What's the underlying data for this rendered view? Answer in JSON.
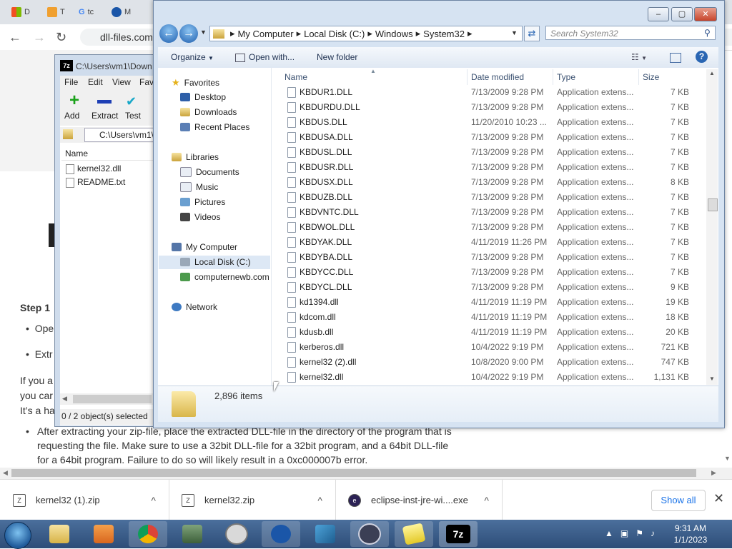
{
  "browser": {
    "tabs": [
      "D",
      "T",
      "tc",
      "M"
    ],
    "address": "dll-files.com",
    "page": {
      "step_heading": "Step 1",
      "bullets": [
        "Ope",
        "Extr"
      ],
      "para_fragments": [
        "If you a",
        "you car",
        "It’s a ha"
      ],
      "extract_paragraph": [
        "After extracting your zip-file, place the extracted DLL-file in the directory of the program that is",
        "requesting the file. Make sure to use a 32bit DLL-file for a 32bit program, and a 64bit DLL-file",
        "for a 64bit program. Failure to do so will likely result in a 0xc000007b error."
      ]
    }
  },
  "downloads": {
    "items": [
      {
        "name": "kernel32 (1).zip"
      },
      {
        "name": "kernel32.zip"
      },
      {
        "name": "eclipse-inst-jre-wi....exe"
      }
    ],
    "show_all": "Show all"
  },
  "zip": {
    "title": "C:\\Users\\vm1\\Down",
    "menu": [
      "File",
      "Edit",
      "View",
      "Fav"
    ],
    "toolbar": [
      "Add",
      "Extract",
      "Test"
    ],
    "path": "C:\\Users\\vm1\\",
    "col_name": "Name",
    "files": [
      "kernel32.dll",
      "README.txt"
    ],
    "status": "0 / 2 object(s) selected"
  },
  "explorer": {
    "breadcrumb": [
      "My Computer",
      "Local Disk (C:)",
      "Windows",
      "System32"
    ],
    "search_placeholder": "Search System32",
    "commands": {
      "organize": "Organize",
      "open_with": "Open with...",
      "new_folder": "New folder"
    },
    "nav": {
      "favorites": "Favorites",
      "fav_items": [
        "Desktop",
        "Downloads",
        "Recent Places"
      ],
      "libraries": "Libraries",
      "lib_items": [
        "Documents",
        "Music",
        "Pictures",
        "Videos"
      ],
      "computer": "My Computer",
      "comp_items": [
        "Local Disk (C:)",
        "computernewb.com"
      ],
      "network": "Network"
    },
    "columns": {
      "name": "Name",
      "date": "Date modified",
      "type": "Type",
      "size": "Size"
    },
    "files": [
      {
        "name": "KBDUR1.DLL",
        "date": "7/13/2009 9:28 PM",
        "type": "Application extens...",
        "size": "7 KB"
      },
      {
        "name": "KBDURDU.DLL",
        "date": "7/13/2009 9:28 PM",
        "type": "Application extens...",
        "size": "7 KB"
      },
      {
        "name": "KBDUS.DLL",
        "date": "11/20/2010 10:23 ...",
        "type": "Application extens...",
        "size": "7 KB"
      },
      {
        "name": "KBDUSA.DLL",
        "date": "7/13/2009 9:28 PM",
        "type": "Application extens...",
        "size": "7 KB"
      },
      {
        "name": "KBDUSL.DLL",
        "date": "7/13/2009 9:28 PM",
        "type": "Application extens...",
        "size": "7 KB"
      },
      {
        "name": "KBDUSR.DLL",
        "date": "7/13/2009 9:28 PM",
        "type": "Application extens...",
        "size": "7 KB"
      },
      {
        "name": "KBDUSX.DLL",
        "date": "7/13/2009 9:28 PM",
        "type": "Application extens...",
        "size": "8 KB"
      },
      {
        "name": "KBDUZB.DLL",
        "date": "7/13/2009 9:28 PM",
        "type": "Application extens...",
        "size": "7 KB"
      },
      {
        "name": "KBDVNTC.DLL",
        "date": "7/13/2009 9:28 PM",
        "type": "Application extens...",
        "size": "7 KB"
      },
      {
        "name": "KBDWOL.DLL",
        "date": "7/13/2009 9:28 PM",
        "type": "Application extens...",
        "size": "7 KB"
      },
      {
        "name": "KBDYAK.DLL",
        "date": "4/11/2019 11:26 PM",
        "type": "Application extens...",
        "size": "7 KB"
      },
      {
        "name": "KBDYBA.DLL",
        "date": "7/13/2009 9:28 PM",
        "type": "Application extens...",
        "size": "7 KB"
      },
      {
        "name": "KBDYCC.DLL",
        "date": "7/13/2009 9:28 PM",
        "type": "Application extens...",
        "size": "7 KB"
      },
      {
        "name": "KBDYCL.DLL",
        "date": "7/13/2009 9:28 PM",
        "type": "Application extens...",
        "size": "9 KB"
      },
      {
        "name": "kd1394.dll",
        "date": "4/11/2019 11:19 PM",
        "type": "Application extens...",
        "size": "19 KB"
      },
      {
        "name": "kdcom.dll",
        "date": "4/11/2019 11:19 PM",
        "type": "Application extens...",
        "size": "18 KB"
      },
      {
        "name": "kdusb.dll",
        "date": "4/11/2019 11:19 PM",
        "type": "Application extens...",
        "size": "20 KB"
      },
      {
        "name": "kerberos.dll",
        "date": "10/4/2022 9:19 PM",
        "type": "Application extens...",
        "size": "721 KB"
      },
      {
        "name": "kernel32 (2).dll",
        "date": "10/8/2020 9:00 PM",
        "type": "Application extens...",
        "size": "747 KB"
      },
      {
        "name": "kernel32.dll",
        "date": "10/4/2022 9:19 PM",
        "type": "Application extens...",
        "size": "1,131 KB"
      }
    ],
    "item_count": "2,896 items"
  },
  "taskbar": {
    "time": "9:31 AM",
    "date": "1/1/2023"
  }
}
